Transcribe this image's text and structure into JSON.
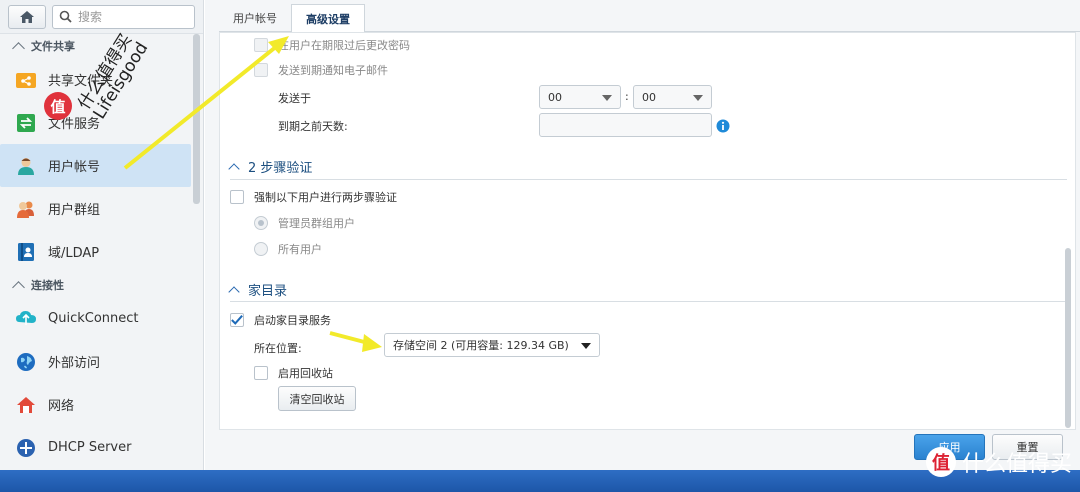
{
  "sidebar": {
    "search_placeholder": "搜索",
    "sections": [
      {
        "title": "文件共享"
      },
      {
        "title": "连接性"
      }
    ],
    "items": [
      {
        "label": "共享文件夹",
        "icon": "share-folder-icon"
      },
      {
        "label": "文件服务",
        "icon": "file-services-icon"
      },
      {
        "label": "用户帐号",
        "icon": "user-icon"
      },
      {
        "label": "用户群组",
        "icon": "group-icon"
      },
      {
        "label": "域/LDAP",
        "icon": "domain-icon"
      },
      {
        "label": "QuickConnect",
        "icon": "quickconnect-icon"
      },
      {
        "label": "外部访问",
        "icon": "globe-icon"
      },
      {
        "label": "网络",
        "icon": "network-icon"
      },
      {
        "label": "DHCP Server",
        "icon": "dhcp-icon"
      }
    ]
  },
  "tabs": [
    {
      "label": "用户帐号"
    },
    {
      "label": "高级设置"
    }
  ],
  "password_expiry": {
    "notify_login_label": "在用户在期限过后更改密码",
    "email_label": "发送到期通知电子邮件",
    "send_at_label": "发送于",
    "hour_value": "00",
    "time_sep": ":",
    "minute_value": "00",
    "days_before_label": "到期之前天数:"
  },
  "two_step": {
    "title": "2 步骤验证",
    "enforce_label": "强制以下用户进行两步骤验证",
    "admin_group_label": "管理员群组用户",
    "all_users_label": "所有用户"
  },
  "home": {
    "title": "家目录",
    "enable_label": "启动家目录服务",
    "location_label": "所在位置:",
    "location_value": "存储空间 2 (可用容量:  129.34 GB)",
    "recycle_label": "启用回收站",
    "empty_recycle_button": "清空回收站"
  },
  "footer": {
    "apply_button": "应用",
    "reset_button": "重置"
  },
  "watermark": {
    "text1": "什么值得买",
    "text2": "Lifeisgood",
    "badge": "值",
    "corner_text": "什么值得买"
  },
  "colors": {
    "accent": "#2a82d0",
    "arrow": "#f2ea2a",
    "bottom_bar": "#1d56a8"
  }
}
